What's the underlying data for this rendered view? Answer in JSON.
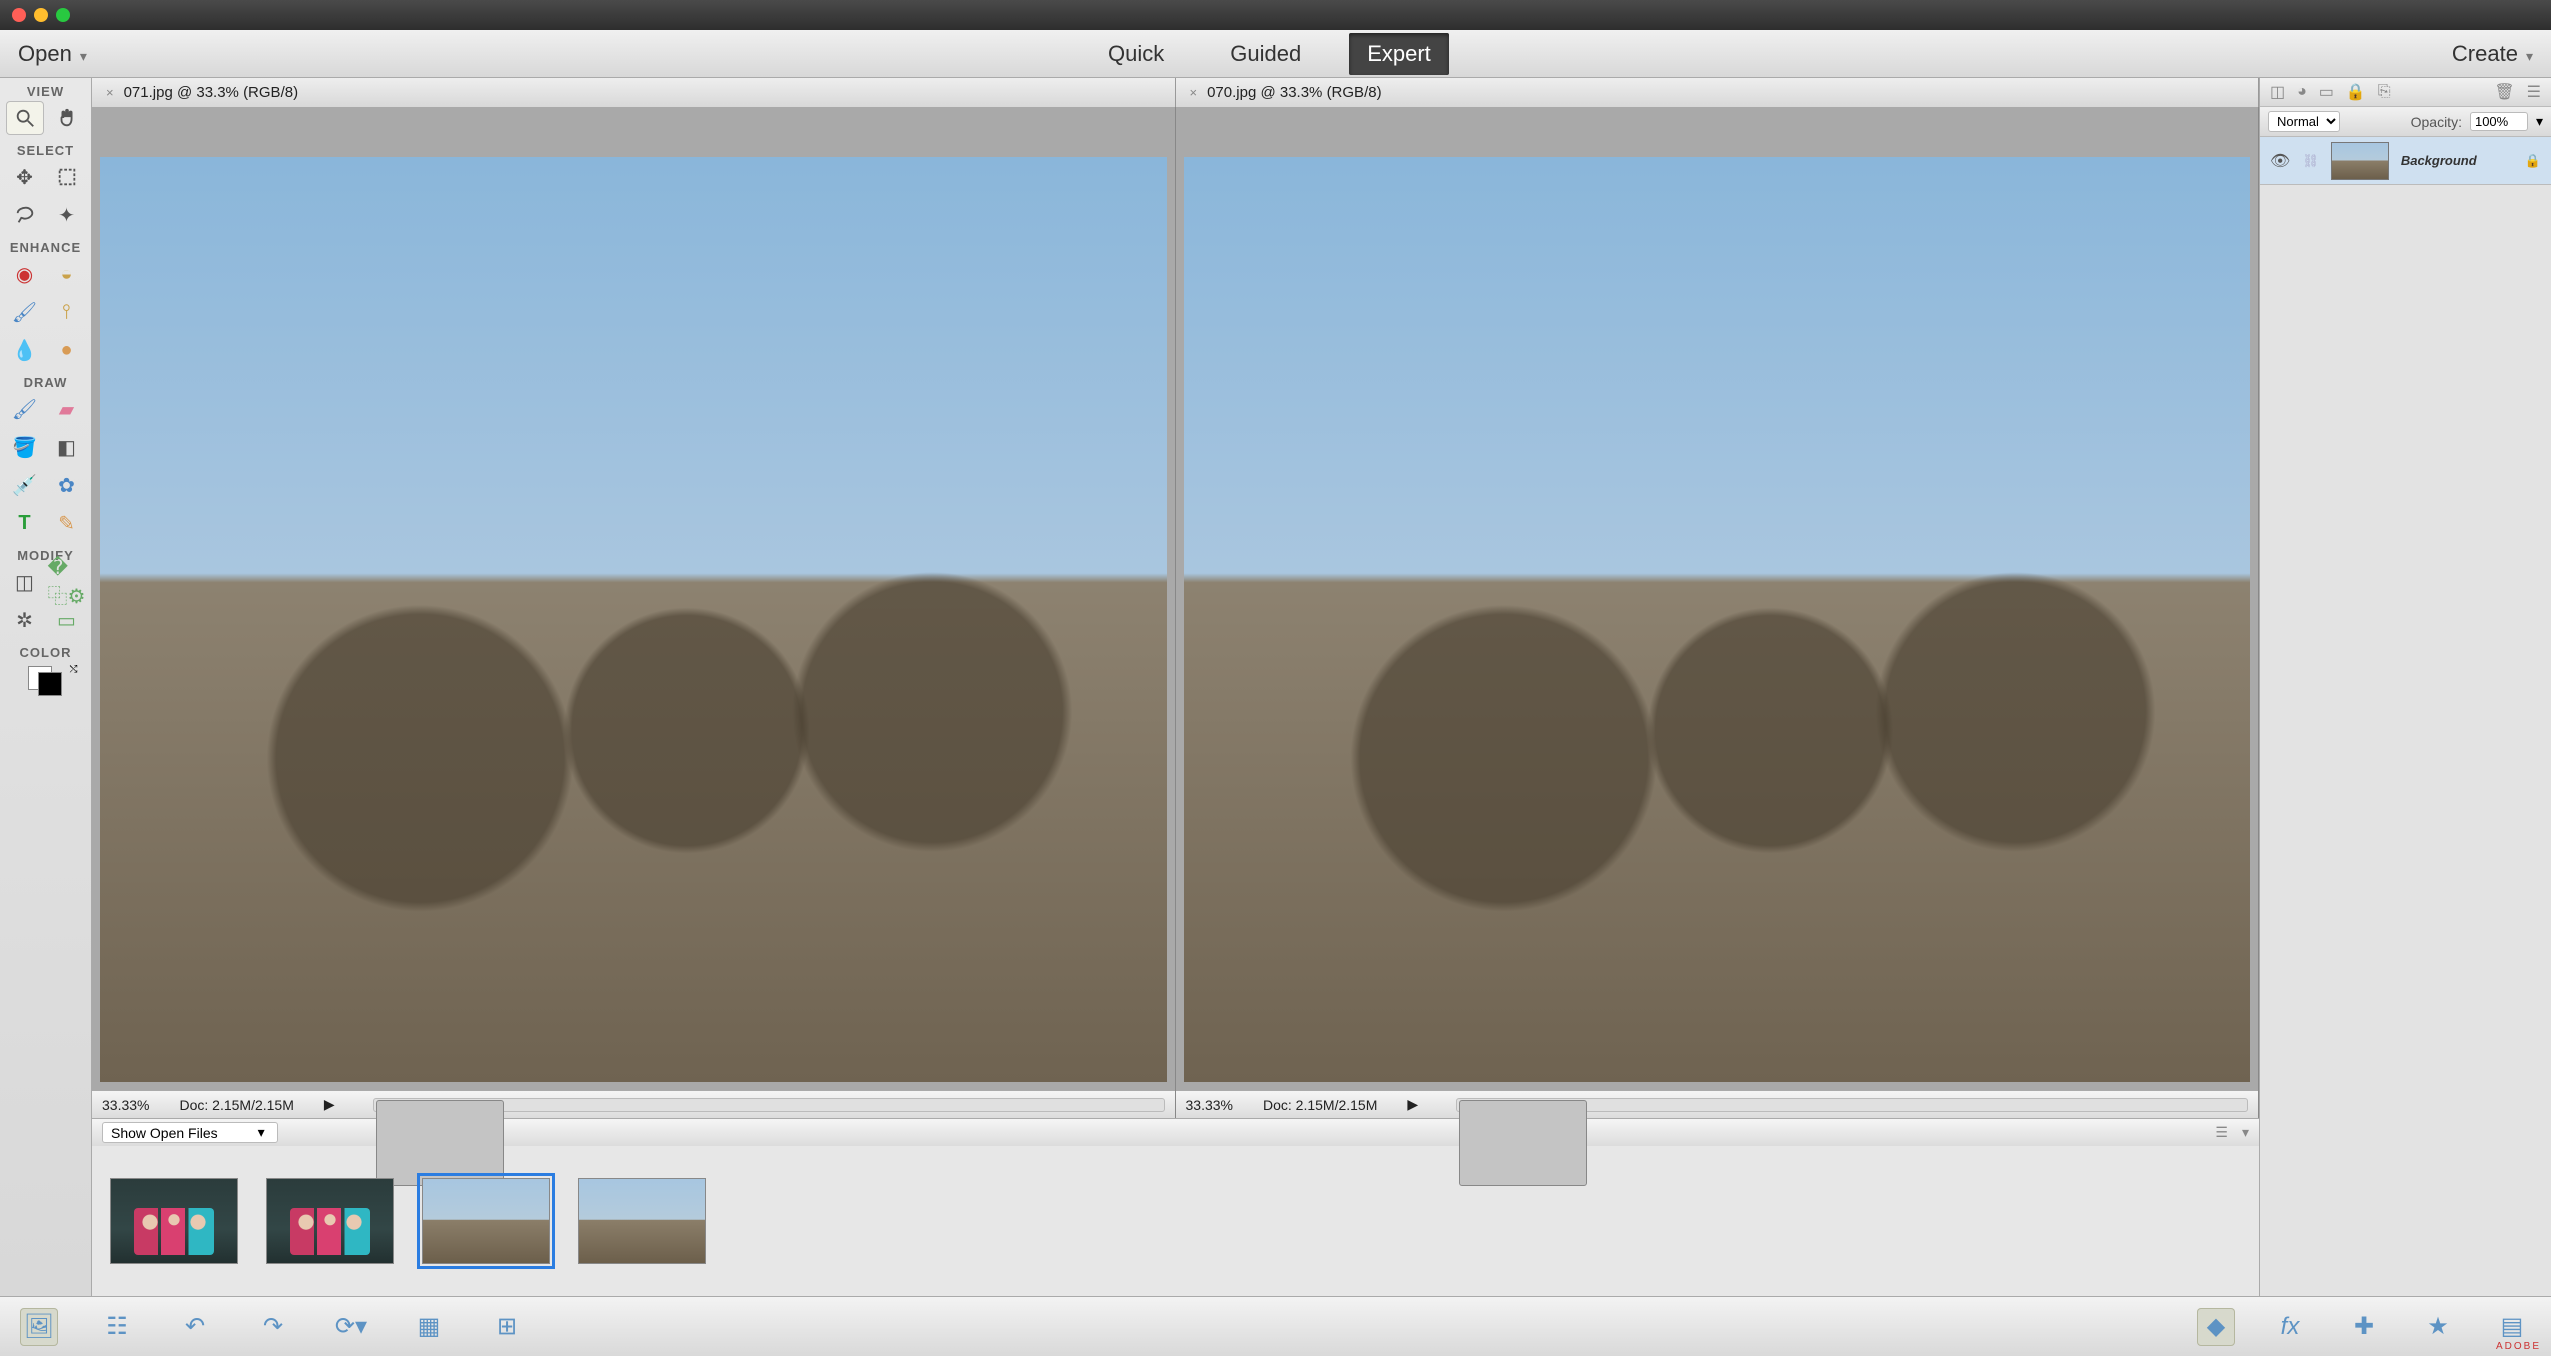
{
  "menubar": {
    "open_label": "Open",
    "create_label": "Create",
    "modes": {
      "quick": "Quick",
      "guided": "Guided",
      "expert": "Expert"
    },
    "active_mode": "expert"
  },
  "tool_sections": {
    "view": "VIEW",
    "select": "SELECT",
    "enhance": "ENHANCE",
    "draw": "DRAW",
    "modify": "MODIFY",
    "color": "COLOR"
  },
  "documents": [
    {
      "title": "071.jpg @ 33.3% (RGB/8)",
      "zoom": "33.33%",
      "doc_size": "Doc: 2.15M/2.15M"
    },
    {
      "title": "070.jpg @ 33.3% (RGB/8)",
      "zoom": "33.33%",
      "doc_size": "Doc: 2.15M/2.15M"
    }
  ],
  "bin": {
    "dropdown_label": "Show Open Files",
    "thumbs": [
      "children-1",
      "children-2",
      "colosseum-071",
      "colosseum-070"
    ],
    "selected_index": 2
  },
  "layers_panel": {
    "blend_mode": "Normal",
    "opacity_label": "Opacity:",
    "opacity_value": "100%",
    "layer_name": "Background"
  },
  "footer_brand": "ADOBE"
}
